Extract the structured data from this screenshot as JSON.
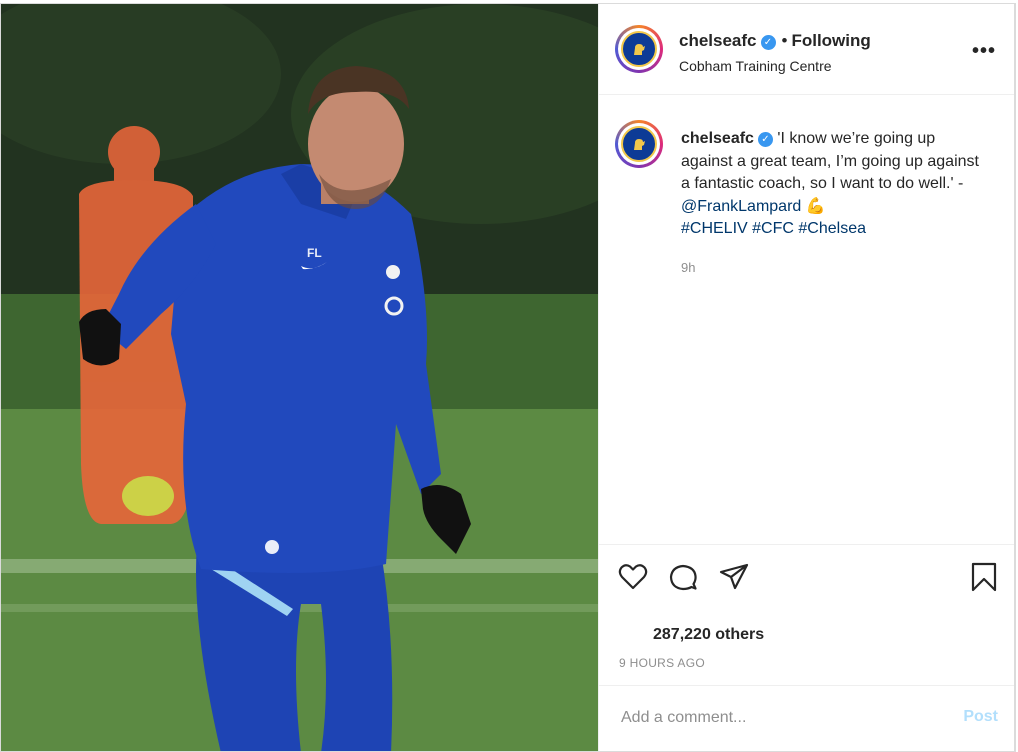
{
  "post": {
    "username": "chelseafc",
    "verified_mark": "✓",
    "separator": "•",
    "follow_status": "Following",
    "location": "Cobham Training Centre",
    "more_label": "•••"
  },
  "caption": {
    "username": "chelseafc",
    "text": "'I know we’re going up against a great team, I’m going up against a fantastic coach, so I want to do well.' - ",
    "mention": "@FrankLampard",
    "emoji": "💪",
    "hashtags": [
      "#CHELIV",
      "#CFC",
      "#Chelsea"
    ],
    "time": "9h"
  },
  "actions": {
    "like_icon": "heart-icon",
    "comment_icon": "comment-icon",
    "share_icon": "send-icon",
    "save_icon": "bookmark-icon"
  },
  "likes": {
    "text": "287,220 others"
  },
  "timestamp": "9 HOURS AGO",
  "comment": {
    "placeholder": "Add a comment...",
    "post_label": "Post"
  },
  "colors": {
    "tracksuit_blue": "#1f48b8",
    "mannequin_orange": "#e8663a",
    "link_blue": "#00376b",
    "verified_blue": "#3897f0",
    "post_button_disabled": "#b2dffc"
  }
}
